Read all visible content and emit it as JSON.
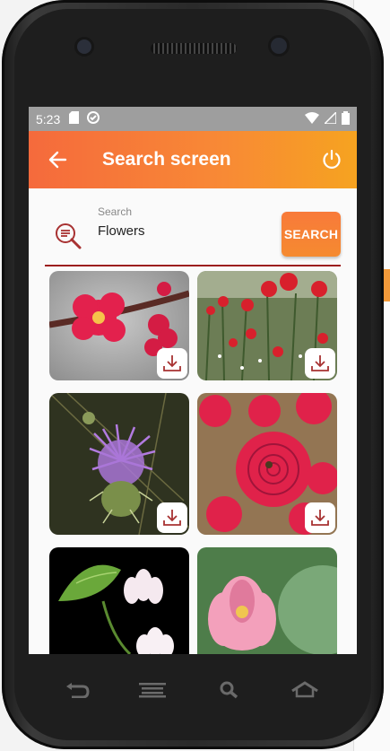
{
  "status_bar": {
    "time": "5:23"
  },
  "app_bar": {
    "title": "Search screen"
  },
  "search": {
    "label": "Search",
    "value": "Flowers",
    "button_label": "SEARCH"
  },
  "images": [
    {
      "name": "red plum blossom",
      "has_download": true
    },
    {
      "name": "red poppy field",
      "has_download": true
    },
    {
      "name": "purple thistle",
      "has_download": true
    },
    {
      "name": "red roses",
      "has_download": true
    },
    {
      "name": "white lotus with leaf",
      "has_download": false
    },
    {
      "name": "pink lotus",
      "has_download": false
    }
  ],
  "icons": {
    "back": "arrow-left-icon",
    "power": "power-icon",
    "search": "search-document-icon",
    "download": "download-icon",
    "nav_back": "nav-back-icon",
    "nav_menu": "nav-menu-icon",
    "nav_search": "nav-search-icon",
    "nav_home": "nav-home-icon"
  },
  "colors": {
    "accent_start": "#f56a3c",
    "accent_end": "#f6a320",
    "underline": "#9c1e1e",
    "download_icon": "#a83232"
  }
}
